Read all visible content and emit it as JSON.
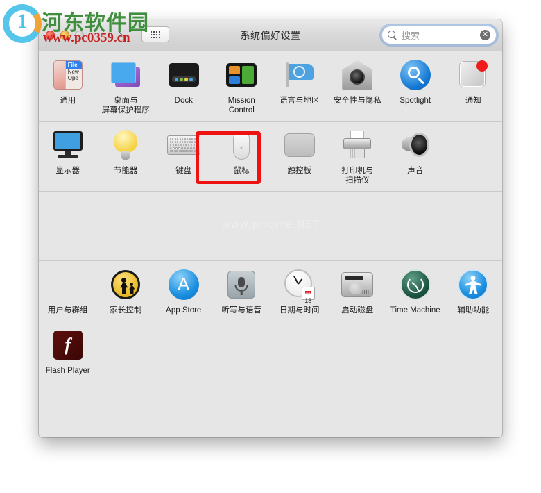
{
  "window": {
    "title": "系统偏好设置",
    "controls": {
      "close": "close-button",
      "minimize": "minimize-button",
      "zoom": "zoom-button"
    },
    "nav": {
      "back": "‹",
      "forward": "›"
    },
    "grid_button_label": "显示全部",
    "search": {
      "placeholder": "搜索",
      "value": "",
      "clear": "✕"
    }
  },
  "watermarks": {
    "logo_char": "1",
    "brand": "河东软件园",
    "url": "www.pc0359.cn",
    "center": "www.pHome.NET"
  },
  "highlight": {
    "target": "键盘",
    "color": "#ee1111"
  },
  "sections": [
    {
      "name": "personal",
      "items": [
        {
          "label": "通用",
          "icon": "general-icon"
        },
        {
          "label": "桌面与\n屏幕保护程序",
          "icon": "desktop-screensaver-icon"
        },
        {
          "label": "Dock",
          "icon": "dock-icon"
        },
        {
          "label": "Mission\nControl",
          "icon": "mission-control-icon"
        },
        {
          "label": "语言与地区",
          "icon": "language-region-icon"
        },
        {
          "label": "安全性与隐私",
          "icon": "security-privacy-icon"
        },
        {
          "label": "Spotlight",
          "icon": "spotlight-icon"
        },
        {
          "label": "通知",
          "icon": "notifications-icon"
        }
      ]
    },
    {
      "name": "hardware",
      "items": [
        {
          "label": "显示器",
          "icon": "displays-icon"
        },
        {
          "label": "节能器",
          "icon": "energy-saver-icon"
        },
        {
          "label": "键盘",
          "icon": "keyboard-icon"
        },
        {
          "label": "鼠标",
          "icon": "mouse-icon"
        },
        {
          "label": "触控板",
          "icon": "trackpad-icon"
        },
        {
          "label": "打印机与\n扫描仪",
          "icon": "printers-scanners-icon"
        },
        {
          "label": "声音",
          "icon": "sound-icon"
        }
      ]
    },
    {
      "name": "internet-accounts",
      "items": []
    },
    {
      "name": "system",
      "items": [
        {
          "label": "用户与群组",
          "icon": "users-groups-icon"
        },
        {
          "label": "家长控制",
          "icon": "parental-controls-icon"
        },
        {
          "label": "App Store",
          "icon": "app-store-icon"
        },
        {
          "label": "听写与语音",
          "icon": "dictation-speech-icon"
        },
        {
          "label": "日期与时间",
          "icon": "date-time-icon"
        },
        {
          "label": "启动磁盘",
          "icon": "startup-disk-icon"
        },
        {
          "label": "Time Machine",
          "icon": "time-machine-icon"
        },
        {
          "label": "辅助功能",
          "icon": "accessibility-icon"
        }
      ]
    },
    {
      "name": "other",
      "items": [
        {
          "label": "Flash Player",
          "icon": "flash-player-icon"
        }
      ]
    }
  ],
  "icon_art": {
    "general_menu": {
      "file": "File",
      "new": "New",
      "open": "Ope"
    },
    "date_month": "JUL",
    "date_day": "18",
    "appstore_glyph": "A",
    "flash_glyph": "f"
  }
}
